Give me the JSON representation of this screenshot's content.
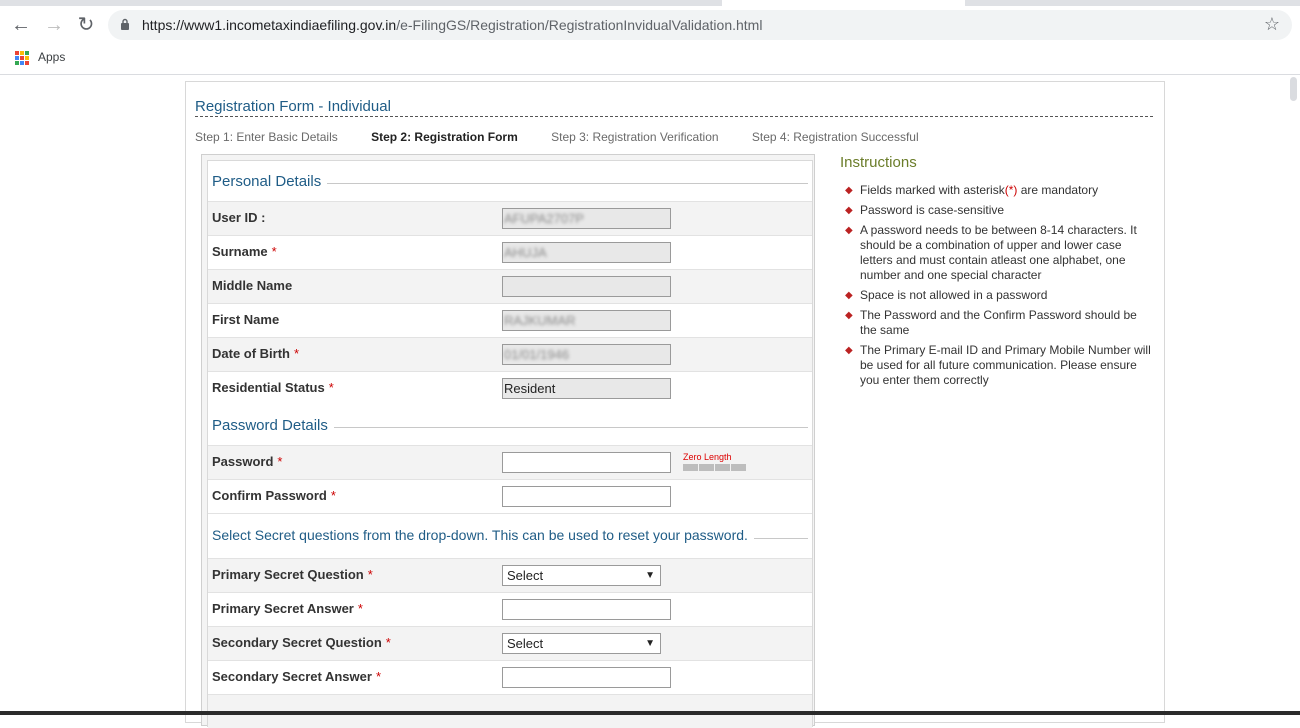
{
  "browser": {
    "url_host": "https://www1.incometaxindiaefiling.gov.in",
    "url_path": "/e-FilingGS/Registration/RegistrationInvidualValidation.html",
    "bookmarks_apps_label": "Apps"
  },
  "page": {
    "title": "Registration Form - Individual",
    "steps": [
      "Step 1: Enter Basic Details",
      "Step 2: Registration Form",
      "Step 3: Registration Verification",
      "Step 4: Registration Successful"
    ],
    "active_step": 1
  },
  "form": {
    "personal_title": "Personal Details",
    "personal_fields": [
      {
        "label": "User ID :",
        "required": false,
        "value": "AFUPA2707P"
      },
      {
        "label": "Surname",
        "required": true,
        "value": "AHUJA"
      },
      {
        "label": "Middle Name",
        "required": false,
        "value": ""
      },
      {
        "label": "First Name",
        "required": true,
        "value": "RAJKUMAR"
      },
      {
        "label": "Date of Birth",
        "required": true,
        "value": "01/01/1946"
      },
      {
        "label": "Residential Status",
        "required": true,
        "value": "Resident"
      }
    ],
    "password_title": "Password Details",
    "password_label": "Password",
    "password_strength": "Zero Length",
    "confirm_password_label": "Confirm Password",
    "secret_title": "Select Secret questions from the drop-down. This can be used to reset your password.",
    "primary_question_label": "Primary Secret Question",
    "primary_question_value": "Select",
    "primary_answer_label": "Primary Secret Answer",
    "secondary_question_label": "Secondary Secret Question",
    "secondary_question_value": "Select",
    "secondary_answer_label": "Secondary Secret Answer",
    "required_mark": "*"
  },
  "instructions": {
    "title": "Instructions",
    "item1_pre": "Fields marked with asterisk",
    "item1_mark": "(*)",
    "item1_post": " are mandatory",
    "items": [
      "Password is case-sensitive",
      "A password needs to be between 8-14 characters. It should be a combination of upper and lower case letters and must contain atleast one alphabet, one number and one special character",
      "Space is not allowed in a password",
      "The Password and the Confirm Password should be the same",
      "The Primary E-mail ID and Primary Mobile Number will be used for all future communication. Please ensure you enter them correctly"
    ]
  },
  "colors": {
    "heading_blue": "#1f5c86",
    "instructions_green": "#6b7d2a",
    "required_red": "#cc0000"
  }
}
